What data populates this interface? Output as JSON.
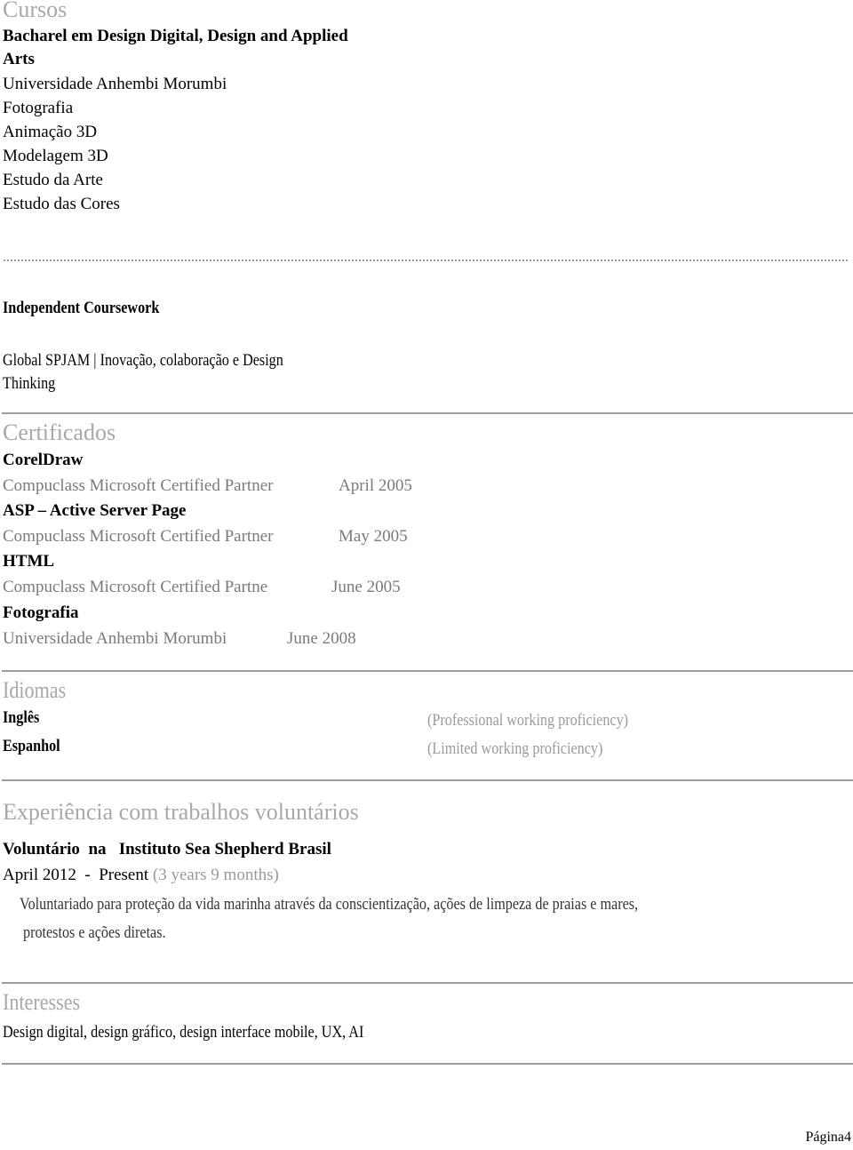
{
  "cursos": {
    "heading": "Cursos",
    "degree_line1": "Bacharel em Design Digital, Design and Applied",
    "degree_line2": "Arts",
    "institution": "Universidade Anhembi Morumbi",
    "items": [
      "Fotografia",
      "Animação 3D",
      "Modelagem 3D",
      "Estudo da Arte",
      "Estudo das Cores"
    ]
  },
  "independent": {
    "heading": "Independent Coursework",
    "line1": "Global SPJAM | Inovação, colaboração e Design",
    "line2": "Thinking"
  },
  "certificados": {
    "heading": "Certificados",
    "items": [
      {
        "name": "CorelDraw",
        "issuer": "Compuclass Microsoft Certified Partner",
        "date": "April 2005"
      },
      {
        "name": "ASP – Active Server Page",
        "issuer": "Compuclass Microsoft Certified Partner",
        "date": "May 2005"
      },
      {
        "name": "HTML",
        "issuer": "Compuclass Microsoft Certified Partne",
        "date": "June 2005"
      },
      {
        "name": "Fotografia",
        "issuer": "Universidade Anhembi Morumbi",
        "date": "June 2008"
      }
    ]
  },
  "idiomas": {
    "heading": "Idiomas",
    "items": [
      {
        "language": "Inglês",
        "level": "(Professional working proficiency)"
      },
      {
        "language": "Espanhol",
        "level": "(Limited working proficiency)"
      }
    ]
  },
  "voluntario": {
    "heading": "Experiência com trabalhos voluntários",
    "role": "Voluntário",
    "connector": "na",
    "org": "Instituto Sea Shepherd Brasil",
    "start": "April 2012",
    "separator": "-",
    "end": "Present",
    "duration": "(3 years 9 months)",
    "desc_line1": "Voluntariado para proteção da vida marinha através da conscientização, ações de limpeza de praias e mares,",
    "desc_line2": "protestos e ações diretas."
  },
  "interesses": {
    "heading": "Interesses",
    "text": "Design digital, design gráfico, design interface mobile, UX, AI"
  },
  "footer": {
    "page_label": "Página4"
  }
}
